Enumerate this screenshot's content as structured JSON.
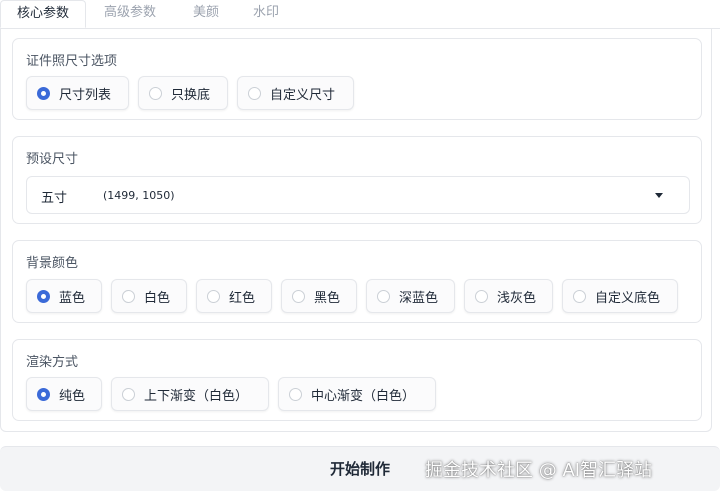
{
  "tabs": [
    {
      "label": "核心参数",
      "active": true
    },
    {
      "label": "高级参数",
      "active": false
    },
    {
      "label": "美颜",
      "active": false
    },
    {
      "label": "水印",
      "active": false
    }
  ],
  "photo_size_options": {
    "title": "证件照尺寸选项",
    "options": [
      "尺寸列表",
      "只换底",
      "自定义尺寸"
    ],
    "selected": "尺寸列表"
  },
  "preset_size": {
    "title": "预设尺寸",
    "value": "五寸",
    "dimensions": "(1499, 1050)"
  },
  "background_color": {
    "title": "背景颜色",
    "options": [
      "蓝色",
      "白色",
      "红色",
      "黑色",
      "深蓝色",
      "浅灰色",
      "自定义底色"
    ],
    "selected": "蓝色"
  },
  "render_mode": {
    "title": "渲染方式",
    "options": [
      "纯色",
      "上下渐变（白色）",
      "中心渐变（白色）"
    ],
    "selected": "纯色"
  },
  "actions": {
    "start_label": "开始制作"
  },
  "watermark_text": "掘金技术社区 @ AI智汇驿站",
  "colors": {
    "accent": "#3b6ad8",
    "border": "#e5e7eb"
  }
}
